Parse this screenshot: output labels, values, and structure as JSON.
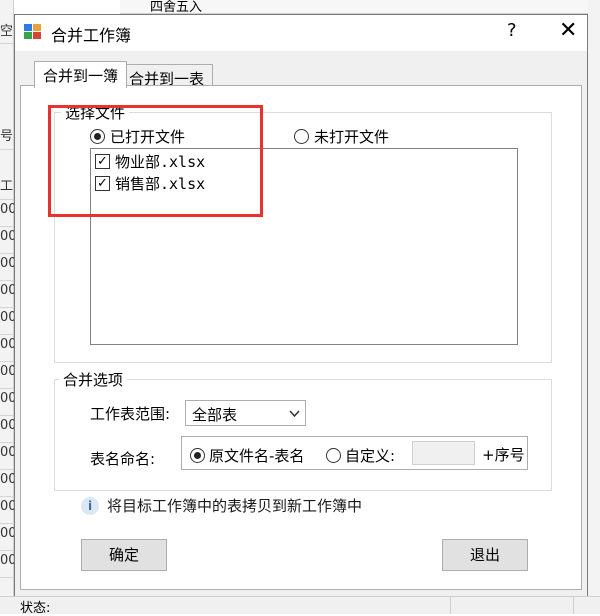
{
  "background": {
    "row_stub": "号",
    "rows": [
      "0",
      "工",
      "00",
      "00",
      "00",
      "00",
      "00",
      "00",
      "00",
      "00",
      "00",
      "00",
      "00",
      "00",
      "00",
      "00"
    ],
    "ribbon_text": "四舍五入",
    "left_stub": "空"
  },
  "dialog": {
    "title": "合并工作簿",
    "help_label": "?",
    "close_label": "✕"
  },
  "tabs": [
    {
      "label": "合并到一簿",
      "active": true
    },
    {
      "label": "合并到一表",
      "active": false
    }
  ],
  "select_files": {
    "legend": "选择文件",
    "options": [
      {
        "label": "已打开文件",
        "selected": true
      },
      {
        "label": "未打开文件",
        "selected": false
      }
    ],
    "files": [
      {
        "name": "物业部.xlsx",
        "checked": true
      },
      {
        "name": "销售部.xlsx",
        "checked": true
      }
    ]
  },
  "merge_options": {
    "legend": "合并选项",
    "sheet_range_label": "工作表范围:",
    "sheet_range_value": "全部表",
    "naming_label": "表名命名:",
    "naming_options": [
      {
        "label": "原文件名-表名",
        "selected": true
      },
      {
        "label": "自定义:",
        "selected": false
      }
    ],
    "custom_value": "",
    "suffix_label": "+序号"
  },
  "info_text": "将目标工作簿中的表拷贝到新工作簿中",
  "buttons": {
    "ok": "确定",
    "exit": "退出"
  },
  "status_label": "状态:",
  "colors": {
    "highlight": "#e8322f",
    "info_icon": "#3d6e9c"
  }
}
